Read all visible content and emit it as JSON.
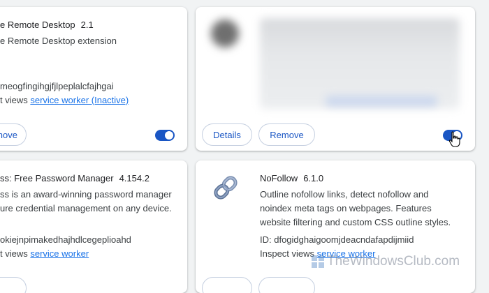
{
  "cards": [
    {
      "name": "e Remote Desktop",
      "version": "2.1",
      "description": [
        "e Remote Desktop extension"
      ],
      "id_text": "meogfingihgjfjlpeplalcfajhgai",
      "inspect_prefix": "t views",
      "inspect_link": "service worker (Inactive)",
      "remove_label": "nove",
      "toggle_on": true
    },
    {
      "details_label": "Details",
      "remove_label": "Remove",
      "toggle_on": true
    },
    {
      "name": "ss: Free Password Manager",
      "version": "4.154.2",
      "description": [
        "ss is an award-winning password manager",
        "ure credential management on any device."
      ],
      "id_text": "okiejnpimakedhajhdlcegeplioahd",
      "inspect_prefix": "t views",
      "inspect_link": "service worker"
    },
    {
      "name": "NoFollow",
      "version": "6.1.0",
      "description": [
        "Outline nofollow links, detect nofollow and",
        "noindex meta tags on webpages. Features",
        "website filtering and custom CSS outline styles."
      ],
      "id_text": "ID: dfogidghaigoomjdeacndafapdijmiid",
      "inspect_prefix": "Inspect views",
      "inspect_link": "service worker",
      "icon": "chain-link-icon"
    }
  ],
  "watermark": "TheWindowsClub.com",
  "colors": {
    "accent": "#1a56c4",
    "link": "#1a73e8",
    "background": "#f1f3f4"
  }
}
